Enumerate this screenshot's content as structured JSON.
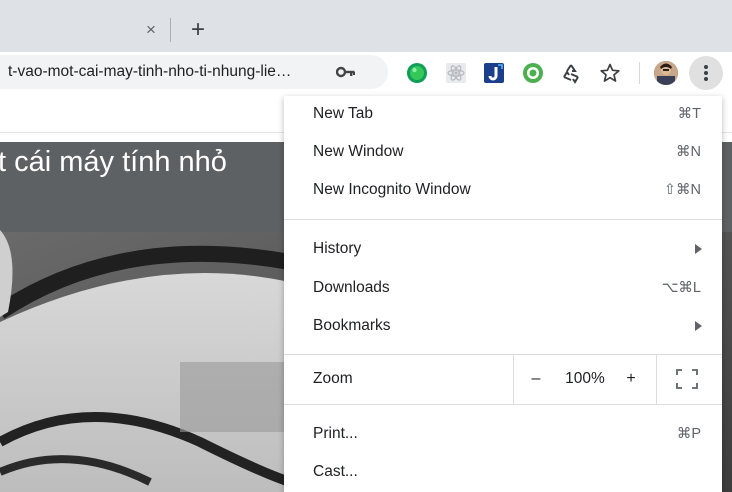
{
  "browser": {
    "tab_close": "×",
    "new_tab": "+",
    "url": "t-vao-mot-cai-may-tinh-nho-ti-nhung-lie…"
  },
  "page": {
    "hero_title": "t cái máy tính nhỏ"
  },
  "menu": {
    "items_top": [
      {
        "label": "New Tab",
        "shortcut": "⌘T"
      },
      {
        "label": "New Window",
        "shortcut": "⌘N"
      },
      {
        "label": "New Incognito Window",
        "shortcut": "⇧⌘N"
      }
    ],
    "history": {
      "label": "History"
    },
    "downloads": {
      "label": "Downloads",
      "shortcut": "⌥⌘L"
    },
    "bookmarks": {
      "label": "Bookmarks"
    },
    "zoom": {
      "label": "Zoom",
      "minus": "–",
      "value": "100%",
      "plus": "+"
    },
    "print": {
      "label": "Print...",
      "shortcut": "⌘P"
    },
    "cast": {
      "label": "Cast..."
    }
  },
  "icons": {
    "extensions": [
      "green-dot-extension-icon",
      "react-extension-icon",
      "j-extension-icon",
      "green-gear-extension-icon",
      "recycle-icon",
      "star-icon"
    ],
    "accent": "#0f9d58"
  }
}
